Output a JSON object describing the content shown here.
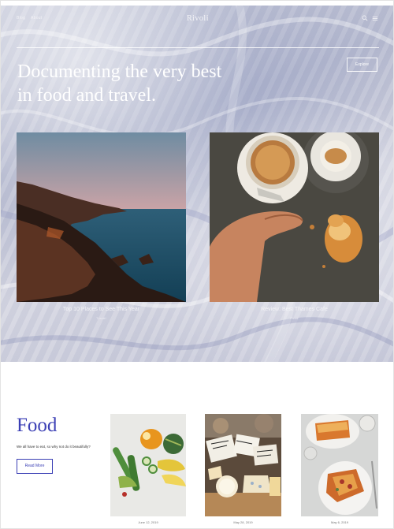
{
  "nav": {
    "links": [
      "Blog",
      "About"
    ],
    "brand": "Rivoli",
    "icons": [
      "search-icon",
      "menu-icon"
    ]
  },
  "hero": {
    "headline_line1": "Documenting the very best",
    "headline_line2": "in food and travel.",
    "explore_label": "Explore"
  },
  "featured": [
    {
      "title": "Top 10 Places to See This Year",
      "category": "Travel"
    },
    {
      "title": "Review: Best Thames Cafe",
      "category": "Food"
    }
  ],
  "food": {
    "title": "Food",
    "description": "We all have to eat, so why not do it beautifully?",
    "read_more": "Read More",
    "posts": [
      {
        "date": "June 12, 2019",
        "title": ""
      },
      {
        "date": "May 28, 2019",
        "title": ""
      },
      {
        "date": "May 6, 2019",
        "title": ""
      }
    ]
  },
  "colors": {
    "accent": "#3b3fb5",
    "hero_text": "#ffffff"
  }
}
